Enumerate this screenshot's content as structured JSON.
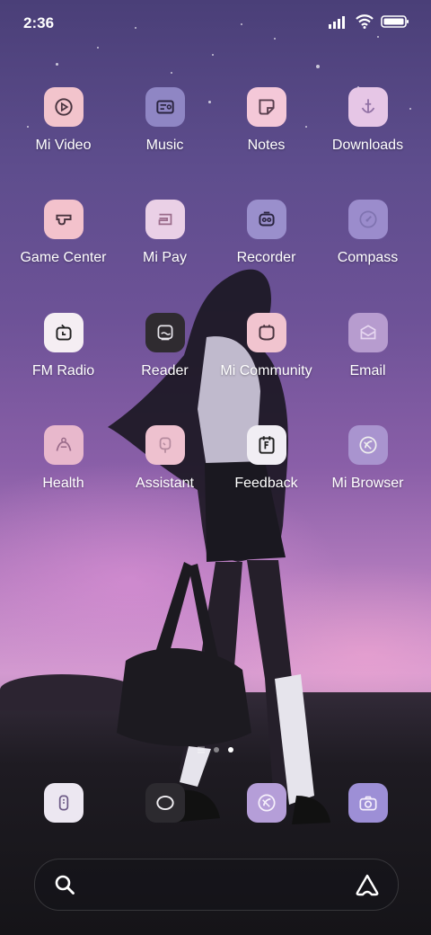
{
  "status_bar": {
    "time": "2:36"
  },
  "apps": [
    {
      "label": "Mi Video",
      "icon": "mi-video-icon",
      "bg": "#f2c4cc"
    },
    {
      "label": "Music",
      "icon": "music-icon",
      "bg": "#8f86c4"
    },
    {
      "label": "Notes",
      "icon": "notes-icon",
      "bg": "#f4c8d8"
    },
    {
      "label": "Downloads",
      "icon": "downloads-icon",
      "bg": "#e6c6e6"
    },
    {
      "label": "Game Center",
      "icon": "game-center-icon",
      "bg": "#f3c2cc"
    },
    {
      "label": "Mi Pay",
      "icon": "mi-pay-icon",
      "bg": "#ead0e6"
    },
    {
      "label": "Recorder",
      "icon": "recorder-icon",
      "bg": "#9a8fcc"
    },
    {
      "label": "Compass",
      "icon": "compass-icon",
      "bg": "#9b8ccc"
    },
    {
      "label": "FM Radio",
      "icon": "fm-radio-icon",
      "bg": "#f5eef3"
    },
    {
      "label": "Reader",
      "icon": "reader-icon",
      "bg": "#2f2b30"
    },
    {
      "label": "Mi Community",
      "icon": "mi-community-icon",
      "bg": "#f1c4cf"
    },
    {
      "label": "Email",
      "icon": "email-icon",
      "bg": "#b79ccf"
    },
    {
      "label": "Health",
      "icon": "health-icon",
      "bg": "#e8b8cc"
    },
    {
      "label": "Assistant",
      "icon": "assistant-icon",
      "bg": "#eec1cf"
    },
    {
      "label": "Feedback",
      "icon": "feedback-icon",
      "bg": "#f1eef4"
    },
    {
      "label": "Mi Browser",
      "icon": "mi-browser-icon",
      "bg": "#a994cf"
    }
  ],
  "dock": [
    {
      "icon": "phone-icon",
      "bg": "#ece7f1"
    },
    {
      "icon": "messages-icon",
      "bg": "#2c2a2f"
    },
    {
      "icon": "browser-icon",
      "bg": "#b59ed8"
    },
    {
      "icon": "camera-icon",
      "bg": "#9d8fd6"
    }
  ],
  "page_indicator": {
    "pages": 2,
    "current": 2
  },
  "search_bar": {
    "left_icon": "search-icon",
    "right_icon": "assistant-a-icon"
  }
}
